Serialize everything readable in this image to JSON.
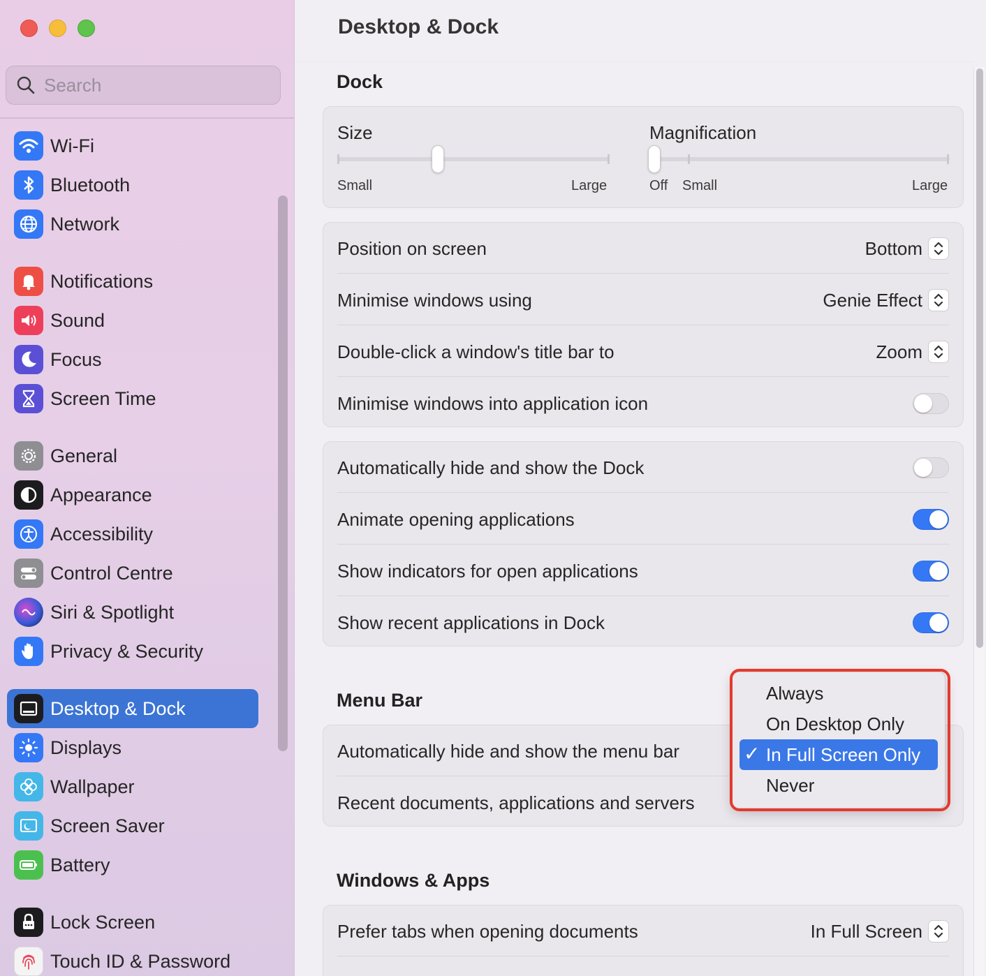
{
  "window": {
    "title": "Desktop & Dock"
  },
  "search": {
    "placeholder": "Search"
  },
  "sidebar": {
    "items": [
      {
        "label": "Wi-Fi",
        "icon": "wifi-icon",
        "color": "#3478f6"
      },
      {
        "label": "Bluetooth",
        "icon": "bluetooth-icon",
        "color": "#3478f6"
      },
      {
        "label": "Network",
        "icon": "globe-icon",
        "color": "#3478f6"
      },
      {
        "label": "Notifications",
        "icon": "bell-icon",
        "color": "#ee4f45"
      },
      {
        "label": "Sound",
        "icon": "speaker-icon",
        "color": "#ee3f5a"
      },
      {
        "label": "Focus",
        "icon": "moon-icon",
        "color": "#5b4fd6"
      },
      {
        "label": "Screen Time",
        "icon": "hourglass-icon",
        "color": "#5b4fd6"
      },
      {
        "label": "General",
        "icon": "gear-icon",
        "color": "#8e8e93"
      },
      {
        "label": "Appearance",
        "icon": "appearance-icon",
        "color": "#1c1c1e"
      },
      {
        "label": "Accessibility",
        "icon": "accessibility-icon",
        "color": "#3478f6"
      },
      {
        "label": "Control Centre",
        "icon": "switches-icon",
        "color": "#8e8e93"
      },
      {
        "label": "Siri & Spotlight",
        "icon": "siri-icon",
        "color": "#2a2a55"
      },
      {
        "label": "Privacy & Security",
        "icon": "hand-icon",
        "color": "#3478f6"
      },
      {
        "label": "Desktop & Dock",
        "icon": "dock-icon",
        "color": "#1c1c1e",
        "active": true
      },
      {
        "label": "Displays",
        "icon": "sun-icon",
        "color": "#3478f6"
      },
      {
        "label": "Wallpaper",
        "icon": "flower-icon",
        "color": "#44b7e8"
      },
      {
        "label": "Screen Saver",
        "icon": "screen-saver-icon",
        "color": "#44b7e8"
      },
      {
        "label": "Battery",
        "icon": "battery-icon",
        "color": "#4cc04f"
      },
      {
        "label": "Lock Screen",
        "icon": "lock-icon",
        "color": "#1c1c1e"
      },
      {
        "label": "Touch ID & Password",
        "icon": "fingerprint-icon",
        "color": "#f2f2f2"
      }
    ]
  },
  "dock": {
    "section_title": "Dock",
    "size": {
      "label": "Size",
      "min_label": "Small",
      "max_label": "Large",
      "value": 0.37
    },
    "magnification": {
      "label": "Magnification",
      "off_label": "Off",
      "min_label": "Small",
      "max_label": "Large",
      "value": 0.0
    },
    "position": {
      "label": "Position on screen",
      "value": "Bottom"
    },
    "minimise_using": {
      "label": "Minimise windows using",
      "value": "Genie Effect"
    },
    "double_click": {
      "label": "Double-click a window's title bar to",
      "value": "Zoom"
    },
    "minimise_into_icon": {
      "label": "Minimise windows into application icon",
      "on": false
    },
    "auto_hide": {
      "label": "Automatically hide and show the Dock",
      "on": false
    },
    "animate": {
      "label": "Animate opening applications",
      "on": true
    },
    "indicators": {
      "label": "Show indicators for open applications",
      "on": true
    },
    "recent_apps": {
      "label": "Show recent applications in Dock",
      "on": true
    }
  },
  "menu_bar": {
    "section_title": "Menu Bar",
    "auto_hide_label": "Automatically hide and show the menu bar",
    "recent_docs_label": "Recent documents, applications and servers",
    "dropdown": {
      "options": [
        "Always",
        "On Desktop Only",
        "In Full Screen Only",
        "Never"
      ],
      "selected": "In Full Screen Only",
      "check": "✓"
    }
  },
  "windows_apps": {
    "section_title": "Windows & Apps",
    "prefer_tabs": {
      "label": "Prefer tabs when opening documents",
      "value": "In Full Screen"
    }
  },
  "colors": {
    "accent": "#3478f6",
    "highlight": "#e43a2b"
  }
}
